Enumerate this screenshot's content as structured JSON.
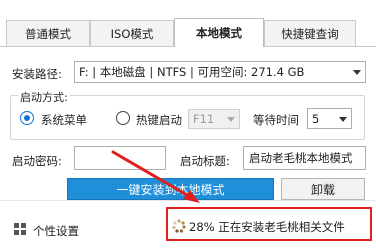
{
  "tabs": [
    {
      "label": "普通模式",
      "active": false
    },
    {
      "label": "ISO模式",
      "active": false
    },
    {
      "label": "本地模式",
      "active": true
    },
    {
      "label": "快捷键查询",
      "active": false
    }
  ],
  "install_path": {
    "label": "安装路径:",
    "value": "F: | 本地磁盘 | NTFS | 可用空间: 271.4 GB"
  },
  "boot_mode": {
    "group_title": "启动方式:",
    "option_system_menu": "系统菜单",
    "option_hotkey": "热键启动",
    "hotkey_value": "F11",
    "wait_label": "等待时间",
    "wait_value": "5"
  },
  "password": {
    "label": "启动密码:",
    "value": ""
  },
  "boot_title": {
    "label": "启动标题:",
    "value": "启动老毛桃本地模式"
  },
  "buttons": {
    "install": "一键安装到本地模式",
    "uninstall": "卸载"
  },
  "footer": {
    "personalize": "个性设置",
    "progress_text": "28% 正在安装老毛桃相关文件",
    "progress_percent": 28
  },
  "colors": {
    "accent": "#1e8fd8",
    "highlight": "#e0201c"
  }
}
